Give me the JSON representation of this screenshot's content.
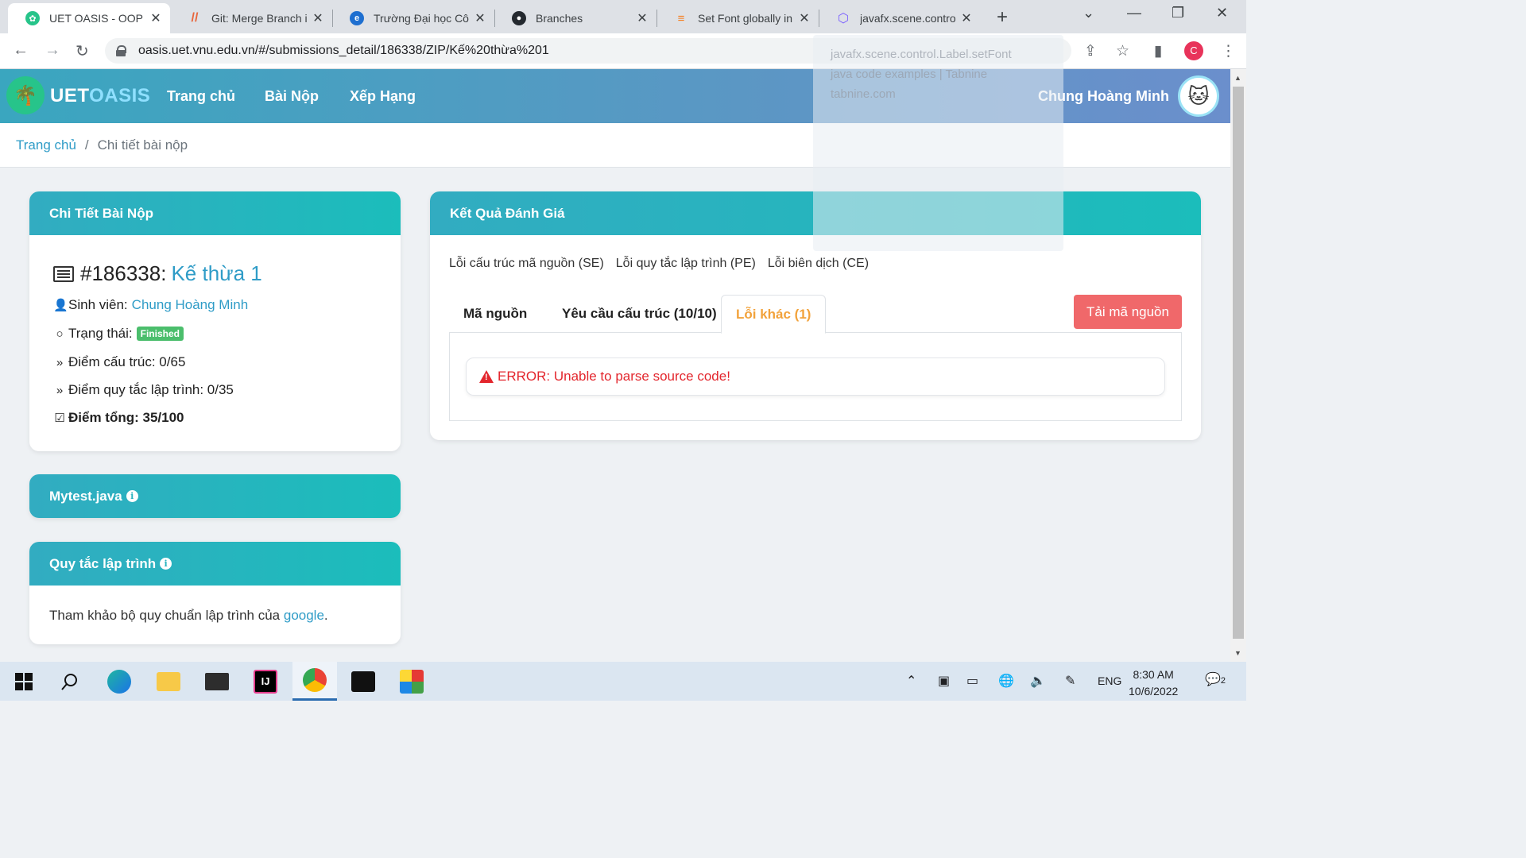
{
  "browser": {
    "tabs": [
      {
        "title": "UET OASIS - OOP A",
        "active": true,
        "favicon_color": "#27c48a"
      },
      {
        "title": "Git: Merge Branch i",
        "active": false,
        "favicon_color": "#e8663d"
      },
      {
        "title": "Trường Đại học Côn",
        "active": false,
        "favicon_color": "#1e6fd0"
      },
      {
        "title": "Branches",
        "active": false,
        "favicon_color": "#24292f"
      },
      {
        "title": "Set Font globally in",
        "active": false,
        "favicon_color": "#f48024"
      },
      {
        "title": "javafx.scene.control",
        "active": false,
        "favicon_color": "#7b61ff"
      }
    ],
    "url": "oasis.uet.vnu.edu.vn/#/submissions_detail/186338/ZIP/Kế%20thừa%201",
    "profile_initial": "C",
    "link_preview": [
      "javafx.scene.control.Label.setFont",
      "java code examples | Tabnine",
      "tabnine.com"
    ]
  },
  "site": {
    "logo_part1": "UET",
    "logo_part2": "OASIS",
    "nav": [
      "Trang chủ",
      "Bài Nộp",
      "Xếp Hạng"
    ],
    "user_name": "Chung Hoàng Minh",
    "breadcrumb": {
      "home": "Trang chủ",
      "sep": "/",
      "current": "Chi tiết bài nộp"
    }
  },
  "detail_card": {
    "header": "Chi Tiết Bài Nộp",
    "submission_id": "#186338:",
    "problem_name": "Kế thừa 1",
    "student_label": "Sinh viên:",
    "student_name": "Chung Hoàng Minh",
    "status_label": "Trạng thái:",
    "status_value": "Finished",
    "structure_score": "Điểm cấu trúc: 0/65",
    "rule_score": "Điểm quy tắc lập trình: 0/35",
    "total_score": "Điểm tổng: 35/100"
  },
  "file_card": {
    "header": "Mytest.java"
  },
  "rules_card": {
    "header": "Quy tắc lập trình",
    "text_before": "Tham khảo bộ quy chuẩn lập trình của ",
    "link": "google",
    "text_after": "."
  },
  "result_card": {
    "header": "Kết Quả Đánh Giá",
    "legend": [
      "Lỗi cấu trúc mã nguồn (SE)",
      "Lỗi quy tắc lập trình (PE)",
      "Lỗi biên dịch (CE)"
    ],
    "tabs": [
      {
        "label": "Mã nguồn",
        "active": false
      },
      {
        "label": "Yêu cầu cấu trúc (10/10)",
        "active": false
      },
      {
        "label": "Lỗi khác (1)",
        "active": true
      }
    ],
    "download_button": "Tải mã nguồn",
    "error_message": "ERROR: Unable to parse source code!"
  },
  "taskbar": {
    "apps": [
      "windows-start",
      "search",
      "edge",
      "file-explorer",
      "mail",
      "intellij",
      "chrome",
      "photos",
      "puzzle-app"
    ],
    "language": "ENG",
    "time": "8:30 AM",
    "date": "10/6/2022",
    "notification_count": "2"
  },
  "colors": {
    "header_gradient_start": "#3aa6bf",
    "card_head": "#1bbdbb",
    "link": "#2f9cc7",
    "active_tab": "#f2a23b",
    "download_button": "#f0686a",
    "error": "#e3262d",
    "badge": "#4bbe6c"
  }
}
